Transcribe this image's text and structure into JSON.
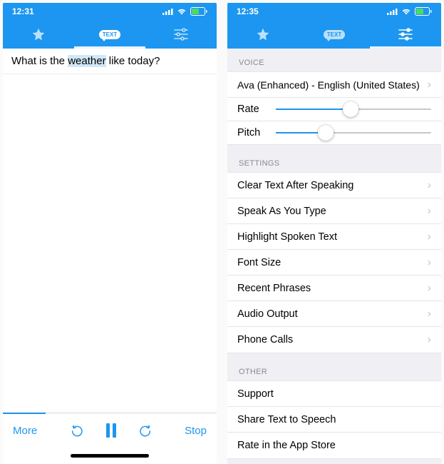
{
  "colors": {
    "accent": "#1c96f0",
    "grayBg": "#efeff4",
    "separator": "#e5e5ea",
    "secondary": "#8a8a8e",
    "chevron": "#c7c7cc"
  },
  "left": {
    "status": {
      "time": "12:31"
    },
    "tabs": {
      "text_label": "TEXT",
      "active_index": 1
    },
    "text": {
      "pre": "What is the ",
      "highlight": "weather",
      "post": " like today?"
    },
    "toolbar": {
      "more_label": "More",
      "stop_label": "Stop",
      "progress_pct": 20
    }
  },
  "right": {
    "status": {
      "time": "12:35"
    },
    "tabs": {
      "text_label": "TEXT",
      "active_index": 2
    },
    "sections": {
      "voice": {
        "header": "VOICE",
        "voice_row_value": "Ava (Enhanced) - English (United States)",
        "rate_label": "Rate",
        "rate_pct": 48,
        "pitch_label": "Pitch",
        "pitch_pct": 32
      },
      "settings": {
        "header": "SETTINGS",
        "items": [
          "Clear Text After Speaking",
          "Speak As You Type",
          "Highlight Spoken Text",
          "Font Size",
          "Recent Phrases",
          "Audio Output",
          "Phone Calls"
        ]
      },
      "other": {
        "header": "OTHER",
        "items": [
          "Support",
          "Share Text to Speech",
          "Rate in the App Store"
        ]
      }
    }
  }
}
